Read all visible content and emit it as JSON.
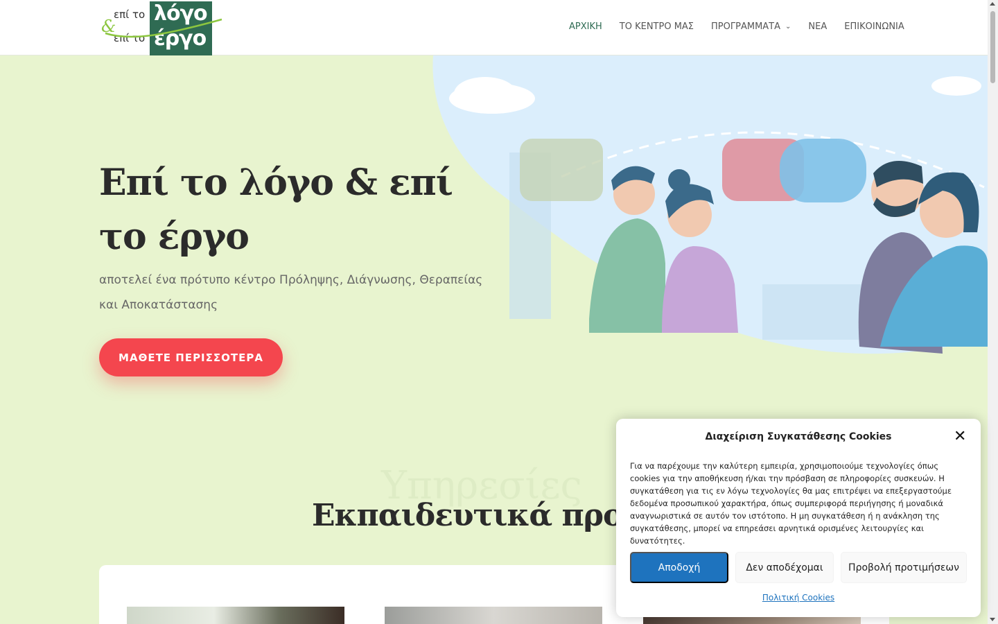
{
  "logo": {
    "line1_small": "επί το",
    "line1_big": "λόγο",
    "line2_small": "επί το",
    "line2_big": "έργο",
    "ampersand": "&",
    "color_green": "#2f6b53",
    "color_light_green": "#8cc63f"
  },
  "nav": {
    "items": [
      {
        "label": "ΑΡΧΙΚΗ",
        "active": true
      },
      {
        "label": "ΤΟ ΚΕΝΤΡΟ ΜΑΣ"
      },
      {
        "label": "ΠΡΟΓΡΑΜΜΑΤΑ",
        "has_dropdown": true
      },
      {
        "label": "ΝΕΑ"
      },
      {
        "label": "ΕΠΙΚΟΙΝΩΝΙΑ"
      }
    ]
  },
  "hero": {
    "title": "Επί το λόγο & επί το έργο",
    "subtitle": "αποτελεί ένα πρότυπο κέντρο Πρόληψης, Διάγνωσης, Θεραπείας και Αποκατάστασης",
    "cta_label": "ΜΑΘΕΤΕ ΠΕΡΙΣΣΟΤΕΡΑ",
    "cta_color": "#f4464e",
    "background_color": "#e8f4cf"
  },
  "section": {
    "ghost_text": "Υπηρεσίες",
    "title": "Εκπαιδευτικά προγράμματα"
  },
  "cookie": {
    "title": "Διαχείριση Συγκατάθεσης Cookies",
    "text": "Για να παρέχουμε την καλύτερη εμπειρία, χρησιμοποιούμε τεχνολογίες όπως cookies για την αποθήκευση ή/και την πρόσβαση σε πληροφορίες συσκευών. Η συγκατάθεση για τις εν λόγω τεχνολογίες θα μας επιτρέψει να επεξεργαστούμε δεδομένα προσωπικού χαρακτήρα, όπως συμπεριφορά περιήγησης ή μοναδικά αναγνωριστικά σε αυτόν τον ιστότοπο. Η μη συγκατάθεση ή η ανάκληση της συγκατάθεσης, μπορεί να επηρεάσει αρνητικά ορισμένες λειτουργίες και δυνατότητες.",
    "accept_label": "Αποδοχή",
    "deny_label": "Δεν αποδέχομαι",
    "prefs_label": "Προβολή προτιμήσεων",
    "policy_link": "Πολιτική Cookies",
    "accent_color": "#1e73be"
  }
}
